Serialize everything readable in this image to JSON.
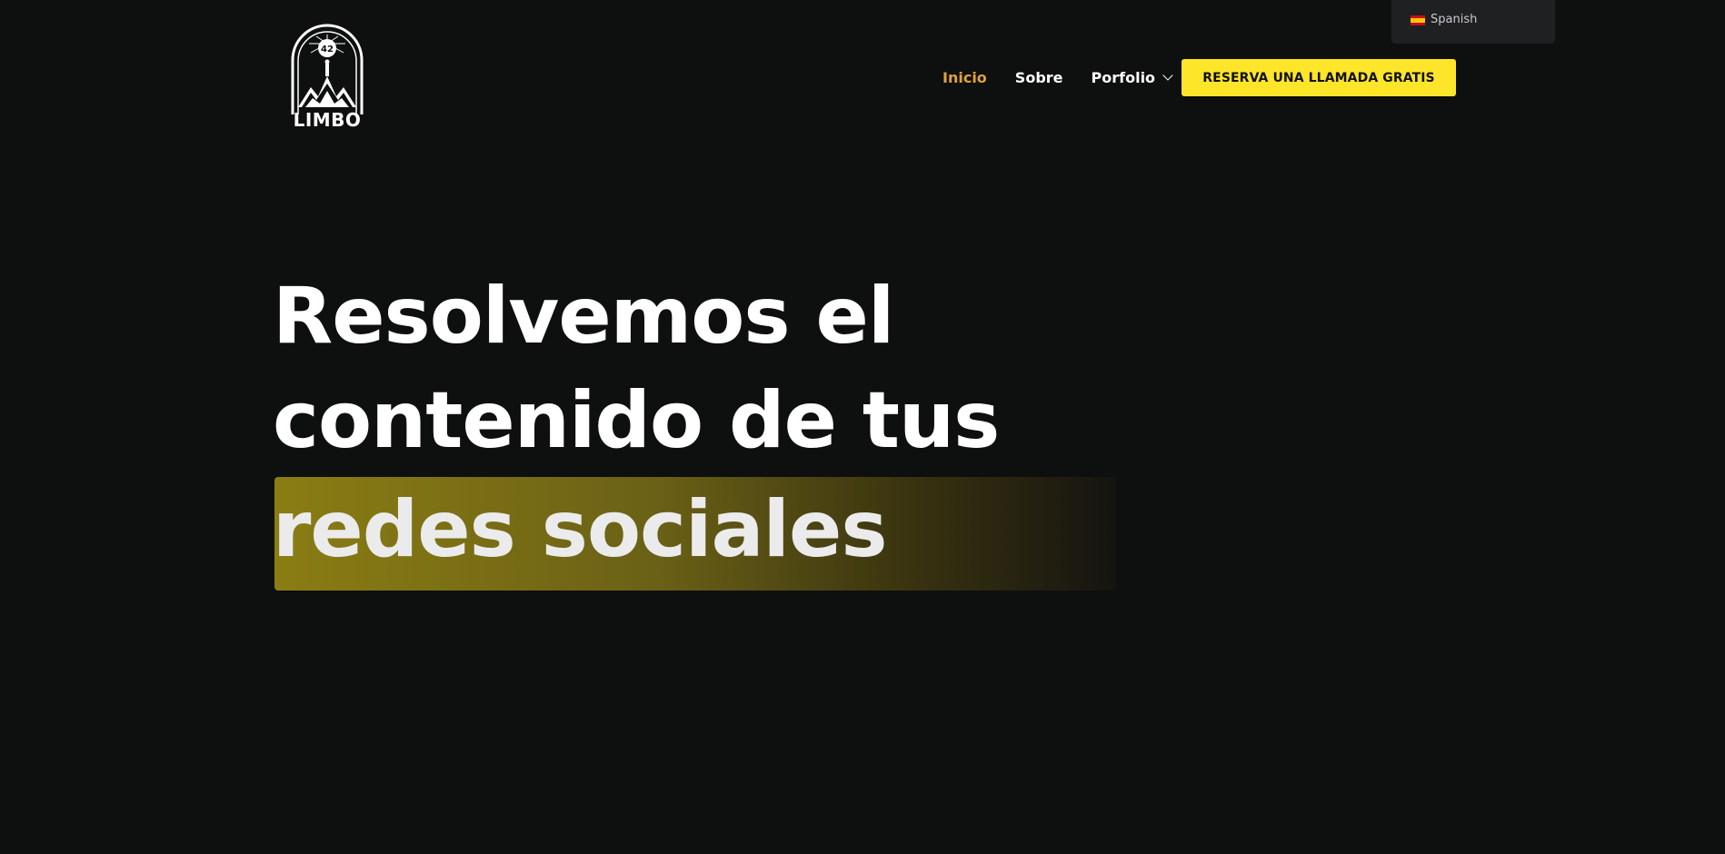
{
  "language_switcher": {
    "label": "Spanish",
    "flag_icon": "spain-flag-icon"
  },
  "logo": {
    "number": "42",
    "text": "LIMBO"
  },
  "nav": {
    "items": [
      {
        "label": "Inicio",
        "active": true
      },
      {
        "label": "Sobre",
        "active": false
      },
      {
        "label": "Porfolio",
        "active": false,
        "has_dropdown": true
      }
    ],
    "cta_label": "RESERVA UNA LLAMADA GRATIS"
  },
  "hero": {
    "line1": "Resolvemos el",
    "line2": "contenido de tus",
    "line3": "redes sociales"
  },
  "colors": {
    "background": "#0e0f0f",
    "accent_active": "#e0a336",
    "cta_background": "#fde52a",
    "highlight_start": "#8a7d14"
  }
}
